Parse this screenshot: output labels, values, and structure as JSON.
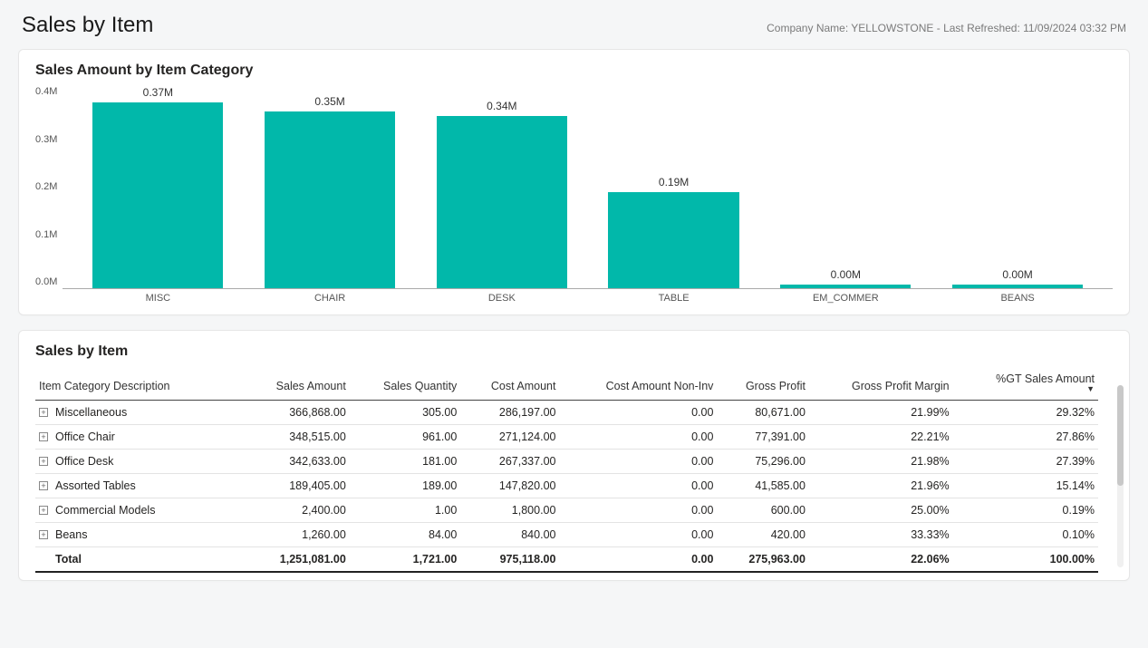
{
  "header": {
    "title": "Sales by Item",
    "meta": "Company Name: YELLOWSTONE - Last Refreshed: 11/09/2024 03:32 PM"
  },
  "chart_card_title": "Sales Amount by Item Category",
  "chart_data": {
    "type": "bar",
    "title": "Sales Amount by Item Category",
    "categories": [
      "MISC",
      "CHAIR",
      "DESK",
      "TABLE",
      "EM_COMMER",
      "BEANS"
    ],
    "values": [
      0.37,
      0.35,
      0.34,
      0.19,
      0.0,
      0.0
    ],
    "data_labels": [
      "0.37M",
      "0.35M",
      "0.34M",
      "0.19M",
      "0.00M",
      "0.00M"
    ],
    "ylabel": "",
    "xlabel": "",
    "ylim": [
      0.0,
      0.4
    ],
    "y_ticks": [
      "0.4M",
      "0.3M",
      "0.2M",
      "0.1M",
      "0.0M"
    ],
    "bar_color": "#01b8aa"
  },
  "table_card_title": "Sales by Item",
  "table": {
    "columns": [
      "Item Category Description",
      "Sales Amount",
      "Sales Quantity",
      "Cost Amount",
      "Cost Amount Non-Inv",
      "Gross Profit",
      "Gross Profit Margin",
      "%GT Sales Amount"
    ],
    "sort_column": "%GT Sales Amount",
    "rows": [
      {
        "desc": "Miscellaneous",
        "sales_amount": "366,868.00",
        "qty": "305.00",
        "cost": "286,197.00",
        "cost_noninv": "0.00",
        "gross_profit": "80,671.00",
        "margin": "21.99%",
        "pct": "29.32%"
      },
      {
        "desc": "Office Chair",
        "sales_amount": "348,515.00",
        "qty": "961.00",
        "cost": "271,124.00",
        "cost_noninv": "0.00",
        "gross_profit": "77,391.00",
        "margin": "22.21%",
        "pct": "27.86%"
      },
      {
        "desc": "Office Desk",
        "sales_amount": "342,633.00",
        "qty": "181.00",
        "cost": "267,337.00",
        "cost_noninv": "0.00",
        "gross_profit": "75,296.00",
        "margin": "21.98%",
        "pct": "27.39%"
      },
      {
        "desc": "Assorted Tables",
        "sales_amount": "189,405.00",
        "qty": "189.00",
        "cost": "147,820.00",
        "cost_noninv": "0.00",
        "gross_profit": "41,585.00",
        "margin": "21.96%",
        "pct": "15.14%"
      },
      {
        "desc": "Commercial Models",
        "sales_amount": "2,400.00",
        "qty": "1.00",
        "cost": "1,800.00",
        "cost_noninv": "0.00",
        "gross_profit": "600.00",
        "margin": "25.00%",
        "pct": "0.19%"
      },
      {
        "desc": "Beans",
        "sales_amount": "1,260.00",
        "qty": "84.00",
        "cost": "840.00",
        "cost_noninv": "0.00",
        "gross_profit": "420.00",
        "margin": "33.33%",
        "pct": "0.10%"
      }
    ],
    "total": {
      "desc": "Total",
      "sales_amount": "1,251,081.00",
      "qty": "1,721.00",
      "cost": "975,118.00",
      "cost_noninv": "0.00",
      "gross_profit": "275,963.00",
      "margin": "22.06%",
      "pct": "100.00%"
    }
  }
}
